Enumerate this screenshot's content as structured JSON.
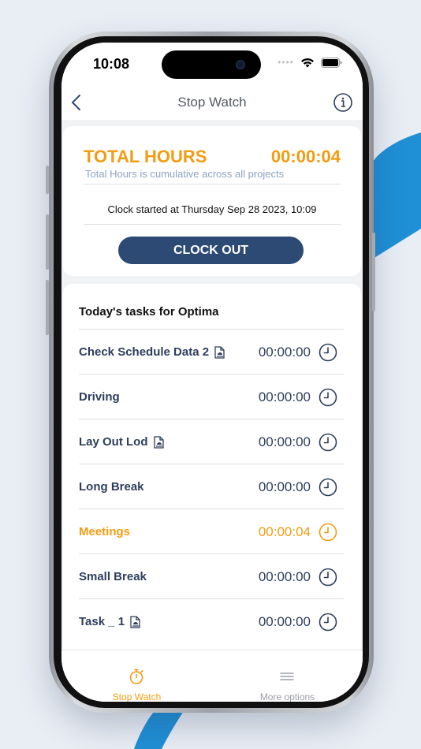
{
  "status_bar": {
    "time": "10:08"
  },
  "nav": {
    "title": "Stop Watch"
  },
  "total": {
    "label": "TOTAL HOURS",
    "value": "00:00:04",
    "subtitle": "Total Hours is cumulative across all projects",
    "clock_started": "Clock started at Thursday Sep 28 2023, 10:09",
    "clock_out_label": "CLOCK OUT"
  },
  "tasks": {
    "heading": "Today's tasks for Optima",
    "items": [
      {
        "name": "Check Schedule Data 2",
        "time": "00:00:00",
        "has_doc": true,
        "active": false
      },
      {
        "name": "Driving",
        "time": "00:00:00",
        "has_doc": false,
        "active": false
      },
      {
        "name": "Lay Out Lod",
        "time": "00:00:00",
        "has_doc": true,
        "active": false
      },
      {
        "name": "Long Break",
        "time": "00:00:00",
        "has_doc": false,
        "active": false
      },
      {
        "name": "Meetings",
        "time": "00:00:04",
        "has_doc": false,
        "active": true
      },
      {
        "name": "Small Break",
        "time": "00:00:00",
        "has_doc": false,
        "active": false
      },
      {
        "name": "Task _ 1",
        "time": "00:00:00",
        "has_doc": true,
        "active": false
      }
    ]
  },
  "tab_bar": {
    "stop_watch_label": "Stop Watch",
    "more_options_label": "More options"
  },
  "colors": {
    "accent": "#f39c12",
    "primary": "#2c4a73",
    "task_text": "#2c3e5c",
    "inactive_tab": "#9a9ea5"
  }
}
